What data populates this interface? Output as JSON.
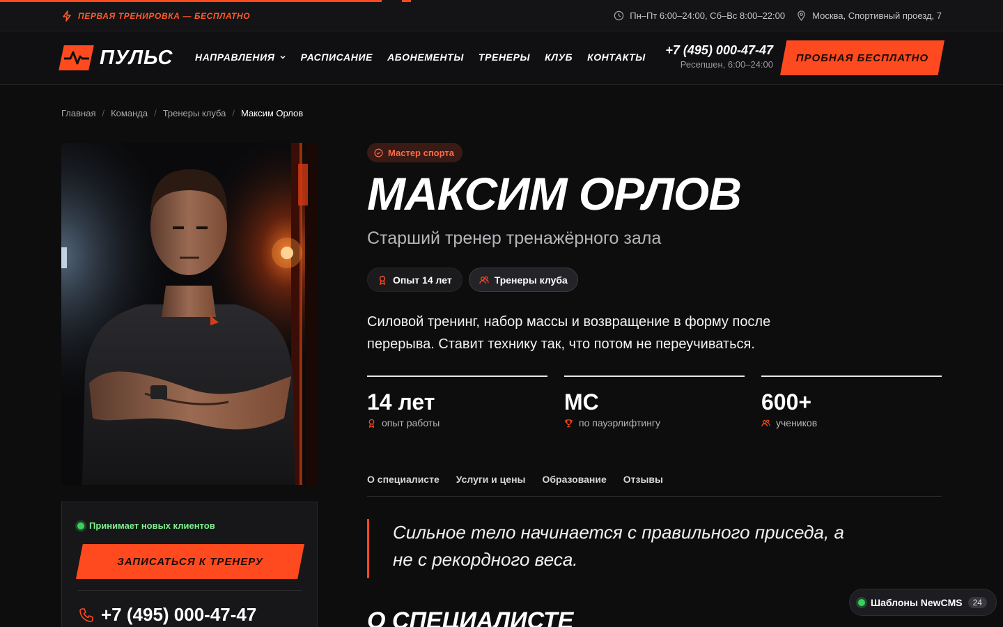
{
  "topbar": {
    "promo": "Первая тренировка — бесплатно",
    "hours": "Пн–Пт 6:00–24:00, Сб–Вс 8:00–22:00",
    "address": "Москва, Спортивный проезд, 7"
  },
  "header": {
    "logo": "ПУЛЬС",
    "nav": [
      {
        "label": "Направления"
      },
      {
        "label": "Расписание"
      },
      {
        "label": "Абонементы"
      },
      {
        "label": "Тренеры"
      },
      {
        "label": "Клуб"
      },
      {
        "label": "Контакты"
      }
    ],
    "phone": "+7 (495) 000-47-47",
    "phone_sub": "Ресепшен, 6:00–24:00",
    "cta": "Пробная бесплатно"
  },
  "breadcrumb": [
    "Главная",
    "Команда",
    "Тренеры клуба",
    "Максим Орлов"
  ],
  "profile": {
    "badge": "Мастер спорта",
    "name": "Максим Орлов",
    "role": "Старший тренер тренажёрного зала",
    "chips": [
      "Опыт 14 лет",
      "Тренеры клуба"
    ],
    "description": "Силовой тренинг, набор массы и возвращение в форму после перерыва. Ставит технику так, что потом не переучиваться.",
    "stats": [
      {
        "value": "14 лет",
        "label": "опыт работы",
        "icon": "medal-icon"
      },
      {
        "value": "МС",
        "label": "по пауэрлифтингу",
        "icon": "trophy-icon"
      },
      {
        "value": "600+",
        "label": "учеников",
        "icon": "users-icon"
      }
    ],
    "tabs": [
      "О специалисте",
      "Услуги и цены",
      "Образование",
      "Отзывы"
    ],
    "quote": "Сильное тело начинается с правильного приседа, а не с рекордного веса.",
    "section_title": "О специалисте"
  },
  "booking": {
    "status": "Принимает новых клиентов",
    "button": "Записаться к тренеру",
    "phone": "+7 (495) 000-47-47"
  },
  "widget": {
    "label": "Шаблоны NewCMS",
    "count": "24"
  },
  "colors": {
    "accent": "#ff4a1f",
    "background": "#0d0d0e",
    "status_green": "#36d35a"
  }
}
